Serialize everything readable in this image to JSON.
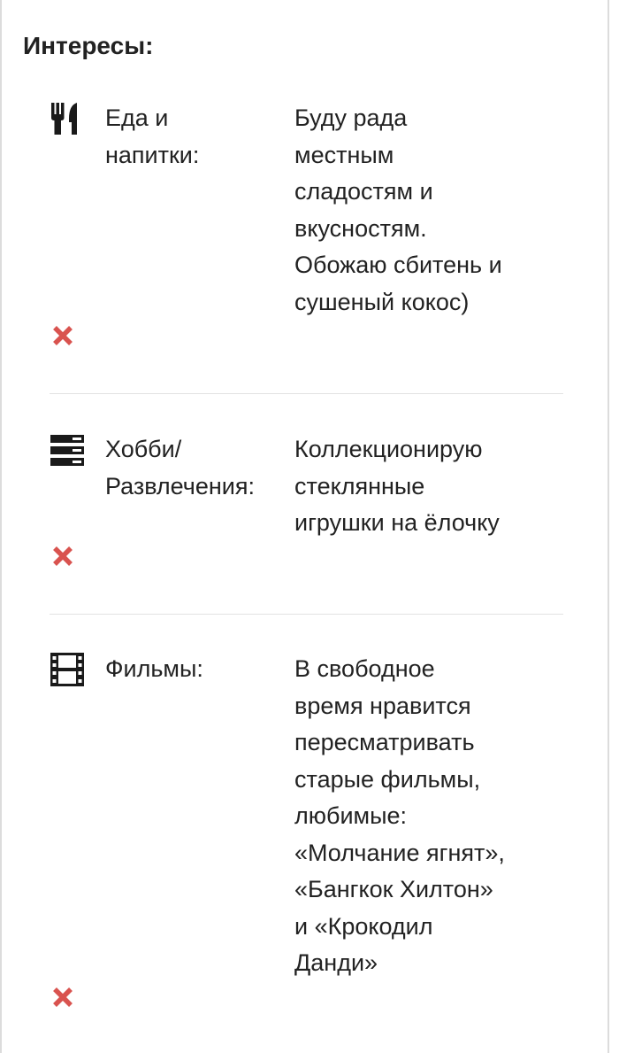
{
  "section": {
    "title": "Интересы:"
  },
  "interests": [
    {
      "icon": "fork-knife-icon",
      "label": "Еда и\nнапитки:",
      "value": "Буду рада\nместным\nсладостям и\nвкусностям.\nОбожаю сбитень и\nсушеный кокос)"
    },
    {
      "icon": "hobby-bars-icon",
      "label": "Хобби/\nРазвлечения:",
      "value": "Коллекционирую\nстеклянные\nигрушки на ёлочку"
    },
    {
      "icon": "film-strip-icon",
      "label": "Фильмы:",
      "value": "В свободное\nвремя нравится\nпересматривать\nстарые фильмы,\nлюбимые:\n«Молчание ягнят»,\n«Бангкок Хилтон»\nи «Крокодил\nДанди»"
    }
  ],
  "remove_icon": "close-icon",
  "colors": {
    "text": "#222222",
    "remove": "#d9534f",
    "divider": "#e2e2e2",
    "border": "#dcdcdc"
  }
}
